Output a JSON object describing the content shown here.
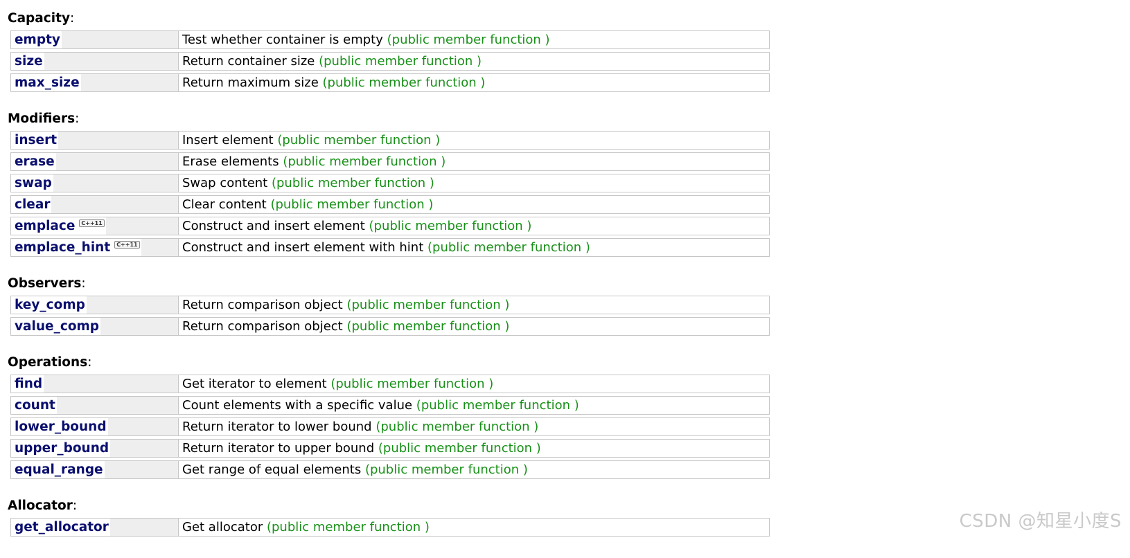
{
  "sections": [
    {
      "heading": "Capacity",
      "members": [
        {
          "name": "empty",
          "desc": "Test whether container is empty",
          "kind": "(public member function )"
        },
        {
          "name": "size",
          "desc": "Return container size",
          "kind": "(public member function )"
        },
        {
          "name": "max_size",
          "desc": "Return maximum size",
          "kind": "(public member function )"
        }
      ]
    },
    {
      "heading": "Modifiers",
      "members": [
        {
          "name": "insert",
          "desc": "Insert element",
          "kind": "(public member function )"
        },
        {
          "name": "erase",
          "desc": "Erase elements",
          "kind": "(public member function )"
        },
        {
          "name": "swap",
          "desc": "Swap content",
          "kind": "(public member function )"
        },
        {
          "name": "clear",
          "desc": "Clear content",
          "kind": "(public member function )"
        },
        {
          "name": "emplace",
          "badge": "C++11",
          "desc": "Construct and insert element",
          "kind": "(public member function )"
        },
        {
          "name": "emplace_hint",
          "badge": "C++11",
          "desc": "Construct and insert element with hint",
          "kind": "(public member function )"
        }
      ]
    },
    {
      "heading": "Observers",
      "members": [
        {
          "name": "key_comp",
          "desc": "Return comparison object",
          "kind": "(public member function )"
        },
        {
          "name": "value_comp",
          "desc": "Return comparison object",
          "kind": "(public member function )"
        }
      ]
    },
    {
      "heading": "Operations",
      "members": [
        {
          "name": "find",
          "desc": "Get iterator to element",
          "kind": "(public member function )"
        },
        {
          "name": "count",
          "desc": "Count elements with a specific value",
          "kind": "(public member function )"
        },
        {
          "name": "lower_bound",
          "desc": "Return iterator to lower bound",
          "kind": "(public member function )"
        },
        {
          "name": "upper_bound",
          "desc": "Return iterator to upper bound",
          "kind": "(public member function )"
        },
        {
          "name": "equal_range",
          "desc": "Get range of equal elements",
          "kind": "(public member function )"
        }
      ]
    },
    {
      "heading": "Allocator",
      "members": [
        {
          "name": "get_allocator",
          "desc": "Get allocator",
          "kind": "(public member function )"
        }
      ]
    }
  ],
  "watermark": "CSDN @知星小度S",
  "colors": {
    "member_name": "#0a0f6e",
    "member_kind": "#189018",
    "cell_border": "#c6c6c6",
    "name_fill": "#eeeeee"
  }
}
